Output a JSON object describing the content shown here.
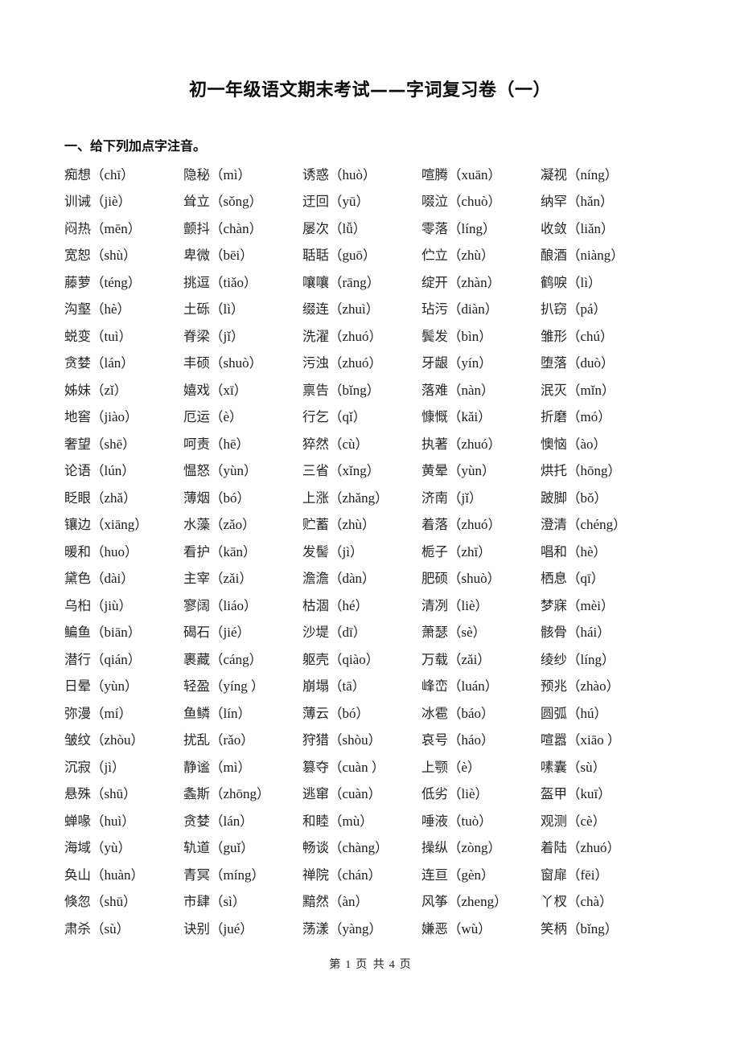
{
  "document": {
    "title": "初一年级语文期末考试——字词复习卷（一）",
    "section_heading": "一、给下列加点字注音。",
    "footer": {
      "page_prefix": "第",
      "current_page": "1",
      "page_mid": "页 共",
      "total_pages": "4",
      "page_suffix": "页"
    }
  },
  "rows": [
    [
      {
        "w": "痴想",
        "p": "chī"
      },
      {
        "w": "隐秘",
        "p": "mì"
      },
      {
        "w": "诱惑",
        "p": "huò"
      },
      {
        "w": "喧腾",
        "p": "xuān"
      },
      {
        "w": "凝视",
        "p": "níng"
      }
    ],
    [
      {
        "w": "训诫",
        "p": "jiè"
      },
      {
        "w": "耸立",
        "p": "sǒng"
      },
      {
        "w": "迂回",
        "p": "yū"
      },
      {
        "w": "啜泣",
        "p": "chuò"
      },
      {
        "w": "纳罕",
        "p": "hǎn"
      }
    ],
    [
      {
        "w": "闷热",
        "p": "mēn"
      },
      {
        "w": "颤抖",
        "p": "chàn"
      },
      {
        "w": "屡次",
        "p": "lǚ"
      },
      {
        "w": "零落",
        "p": "líng"
      },
      {
        "w": "收敛",
        "p": "liǎn"
      }
    ],
    [
      {
        "w": "宽恕",
        "p": "shù"
      },
      {
        "w": "卑微",
        "p": "bēi"
      },
      {
        "w": "聒聒",
        "p": "guō"
      },
      {
        "w": "伫立",
        "p": "zhù"
      },
      {
        "w": "酿酒",
        "p": "niàng"
      }
    ],
    [
      {
        "w": "藤萝",
        "p": "téng"
      },
      {
        "w": "挑逗",
        "p": "tiǎo"
      },
      {
        "w": "嚷嚷",
        "p": "rāng"
      },
      {
        "w": "绽开",
        "p": "zhàn"
      },
      {
        "w": "鹤唳",
        "p": "lì"
      }
    ],
    [
      {
        "w": "沟壑",
        "p": "hè"
      },
      {
        "w": "土砾",
        "p": "lì"
      },
      {
        "w": "缀连",
        "p": "zhuì"
      },
      {
        "w": "玷污",
        "p": "diàn"
      },
      {
        "w": "扒窃",
        "p": "pá"
      }
    ],
    [
      {
        "w": "蜕变",
        "p": "tuì"
      },
      {
        "w": "脊梁",
        "p": "jǐ"
      },
      {
        "w": "洗濯",
        "p": "zhuó"
      },
      {
        "w": "鬓发",
        "p": "bìn"
      },
      {
        "w": "雏形",
        "p": "chú"
      }
    ],
    [
      {
        "w": "贪婪",
        "p": "lán"
      },
      {
        "w": "丰硕",
        "p": "shuò"
      },
      {
        "w": "污浊",
        "p": "zhuó"
      },
      {
        "w": "牙龈",
        "p": "yín"
      },
      {
        "w": "堕落",
        "p": "duò"
      }
    ],
    [
      {
        "w": "姊妹",
        "p": "zǐ"
      },
      {
        "w": "嬉戏",
        "p": "xī"
      },
      {
        "w": "禀告",
        "p": "bǐng"
      },
      {
        "w": "落难",
        "p": "nàn"
      },
      {
        "w": "泯灭",
        "p": "mǐn"
      }
    ],
    [
      {
        "w": "地窖",
        "p": "jiào"
      },
      {
        "w": "厄运",
        "p": "è"
      },
      {
        "w": "行乞",
        "p": "qǐ"
      },
      {
        "w": "慷慨",
        "p": "kǎi"
      },
      {
        "w": "折磨",
        "p": "mó"
      }
    ],
    [
      {
        "w": "奢望",
        "p": "shē"
      },
      {
        "w": "呵责",
        "p": "hē"
      },
      {
        "w": "猝然",
        "p": "cù"
      },
      {
        "w": "执著",
        "p": "zhuó"
      },
      {
        "w": "懊恼",
        "p": "ào"
      }
    ],
    [
      {
        "w": "论语",
        "p": "lún"
      },
      {
        "w": "愠怒",
        "p": "yùn"
      },
      {
        "w": "三省",
        "p": "xǐng"
      },
      {
        "w": "黄晕",
        "p": "yùn"
      },
      {
        "w": "烘托",
        "p": "hōng"
      }
    ],
    [
      {
        "w": "眨眼",
        "p": "zhǎ"
      },
      {
        "w": "薄烟",
        "p": "bó"
      },
      {
        "w": "上涨",
        "p": "zhǎng"
      },
      {
        "w": "济南",
        "p": "jǐ"
      },
      {
        "w": "跛脚",
        "p": "bǒ"
      }
    ],
    [
      {
        "w": "镶边",
        "p": "xiāng"
      },
      {
        "w": "水藻",
        "p": "zǎo"
      },
      {
        "w": "贮蓄",
        "p": "zhù"
      },
      {
        "w": "着落",
        "p": "zhuó"
      },
      {
        "w": "澄清",
        "p": "chéng"
      }
    ],
    [
      {
        "w": "暖和",
        "p": "huo"
      },
      {
        "w": "看护",
        "p": "kān"
      },
      {
        "w": "发髻",
        "p": "jì"
      },
      {
        "w": "栀子",
        "p": "zhī"
      },
      {
        "w": "唱和",
        "p": "hè"
      }
    ],
    [
      {
        "w": "黛色",
        "p": "dài"
      },
      {
        "w": "主宰",
        "p": "zǎi"
      },
      {
        "w": "澹澹",
        "p": "dàn"
      },
      {
        "w": "肥硕",
        "p": "shuò"
      },
      {
        "w": "栖息",
        "p": "qī"
      }
    ],
    [
      {
        "w": "乌桕",
        "p": "jiù"
      },
      {
        "w": "寥阔",
        "p": "liáo"
      },
      {
        "w": "枯涸",
        "p": "hé"
      },
      {
        "w": "清冽",
        "p": "liè"
      },
      {
        "w": "梦寐",
        "p": "mèi"
      }
    ],
    [
      {
        "w": "鳊鱼",
        "p": "biān"
      },
      {
        "w": "碣石",
        "p": "jié"
      },
      {
        "w": "沙堤",
        "p": "dī"
      },
      {
        "w": "萧瑟",
        "p": "sè"
      },
      {
        "w": "骸骨",
        "p": "hái"
      }
    ],
    [
      {
        "w": "潜行",
        "p": "qián"
      },
      {
        "w": "裹藏",
        "p": "cáng"
      },
      {
        "w": "躯壳",
        "p": "qiào"
      },
      {
        "w": "万载",
        "p": "zǎi"
      },
      {
        "w": "绫纱",
        "p": "líng"
      }
    ],
    [
      {
        "w": "日晕",
        "p": "yùn"
      },
      {
        "w": "轻盈",
        "p": "yíng "
      },
      {
        "w": "崩塌",
        "p": "tā"
      },
      {
        "w": "峰峦",
        "p": "luán"
      },
      {
        "w": "预兆",
        "p": "zhào"
      }
    ],
    [
      {
        "w": "弥漫",
        "p": "mí"
      },
      {
        "w": "鱼鳞",
        "p": "lín"
      },
      {
        "w": "薄云",
        "p": "bó"
      },
      {
        "w": "冰雹",
        "p": "báo"
      },
      {
        "w": "圆弧",
        "p": "hú"
      }
    ],
    [
      {
        "w": "皱纹",
        "p": "zhòu"
      },
      {
        "w": "扰乱",
        "p": "rǎo"
      },
      {
        "w": "狩猎",
        "p": "shòu"
      },
      {
        "w": "哀号",
        "p": "háo"
      },
      {
        "w": "喧嚣",
        "p": "xiāo "
      }
    ],
    [
      {
        "w": "沉寂",
        "p": "jì"
      },
      {
        "w": "静谧",
        "p": "mì"
      },
      {
        "w": "篡夺",
        "p": "cuàn "
      },
      {
        "w": "上颚",
        "p": "è"
      },
      {
        "w": "嗉囊",
        "p": "sù"
      }
    ],
    [
      {
        "w": "悬殊",
        "p": "shū"
      },
      {
        "w": "螽斯",
        "p": "zhōng"
      },
      {
        "w": "逃窜",
        "p": "cuàn"
      },
      {
        "w": "低劣",
        "p": "liè"
      },
      {
        "w": "盔甲",
        "p": "kuī"
      }
    ],
    [
      {
        "w": "蝉喙",
        "p": "huì"
      },
      {
        "w": "贪婪",
        "p": "lán"
      },
      {
        "w": "和睦",
        "p": "mù"
      },
      {
        "w": "唾液",
        "p": "tuò"
      },
      {
        "w": "观测",
        "p": "cè"
      }
    ],
    [
      {
        "w": "海域",
        "p": "yù"
      },
      {
        "w": "轨道",
        "p": "guǐ"
      },
      {
        "w": "畅谈",
        "p": "chàng"
      },
      {
        "w": "操纵",
        "p": "zòng"
      },
      {
        "w": "着陆",
        "p": "zhuó"
      }
    ],
    [
      {
        "w": "奂山",
        "p": "huàn"
      },
      {
        "w": "青冥",
        "p": "míng"
      },
      {
        "w": "禅院",
        "p": "chán"
      },
      {
        "w": "连亘",
        "p": "gèn"
      },
      {
        "w": "窗扉",
        "p": "fēi"
      }
    ],
    [
      {
        "w": "倏忽",
        "p": "shū"
      },
      {
        "w": "市肆",
        "p": "sì"
      },
      {
        "w": "黯然",
        "p": "àn"
      },
      {
        "w": "风筝",
        "p": "zheng"
      },
      {
        "w": "丫杈",
        "p": "chà"
      }
    ],
    [
      {
        "w": "肃杀",
        "p": "sù"
      },
      {
        "w": "诀别",
        "p": "jué"
      },
      {
        "w": "荡漾",
        "p": "yàng"
      },
      {
        "w": "嫌恶",
        "p": "wù"
      },
      {
        "w": "笑柄",
        "p": "bǐng"
      }
    ]
  ],
  "punctuation": {
    "open_paren": "（",
    "close_paren": "）"
  }
}
